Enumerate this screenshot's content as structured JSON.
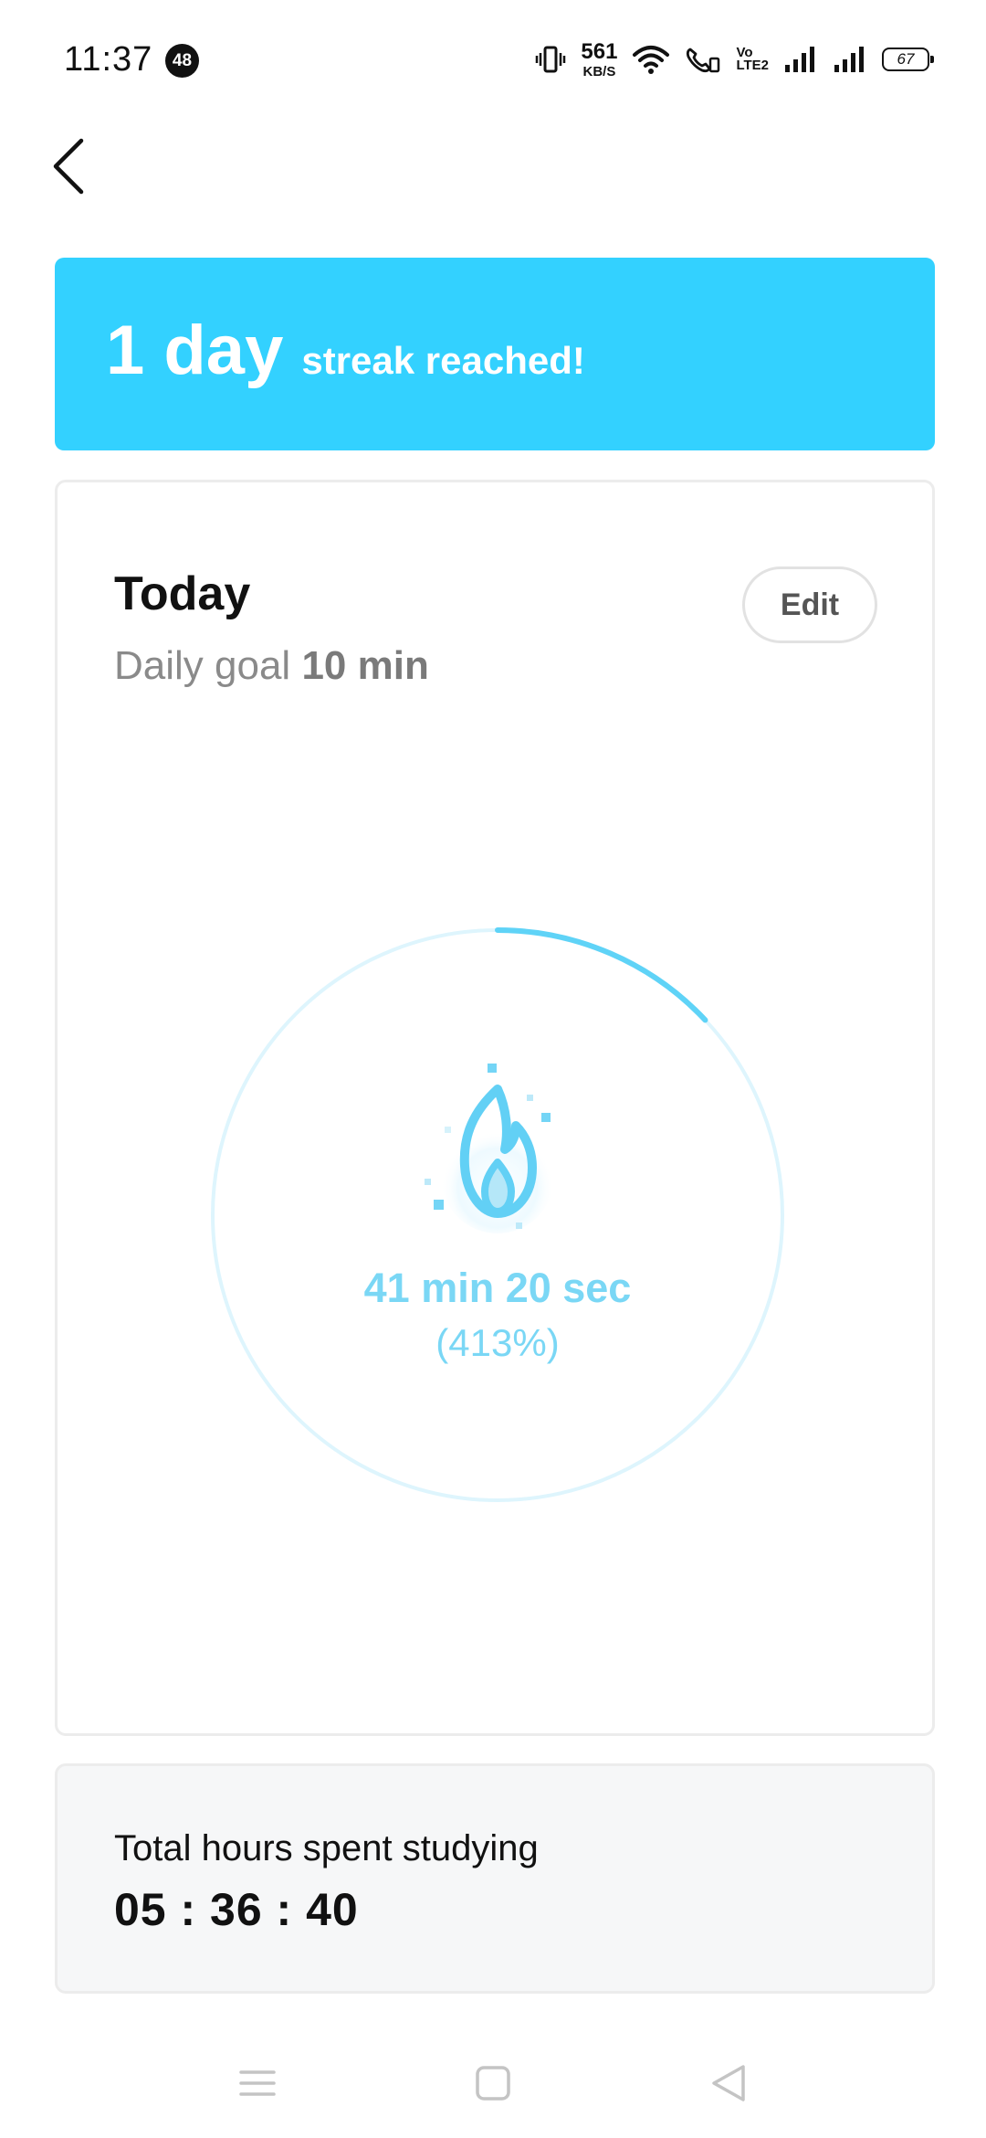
{
  "status_bar": {
    "time": "11:37",
    "notification_count": "48",
    "net_speed": "561",
    "net_speed_unit": "KB/S",
    "volte_top": "Vo",
    "volte_bottom": "LTE2",
    "battery": "67"
  },
  "streak": {
    "count": "1 day",
    "text": "streak reached!",
    "color": "#33d1ff"
  },
  "today": {
    "title": "Today",
    "goal_label": "Daily goal",
    "goal_value": "10 min",
    "edit_label": "Edit",
    "progress_time": "41 min 20 sec",
    "progress_percent": "(413%)",
    "ring_fill_fraction": 0.13,
    "accent_color": "#5fd3f7"
  },
  "total": {
    "label": "Total hours spent studying",
    "value": "05 : 36 : 40"
  },
  "icons": {
    "back": "chevron-left-icon",
    "fire": "fire-icon",
    "menu": "menu-icon",
    "home": "home-square-icon",
    "nav_back": "triangle-back-icon"
  }
}
